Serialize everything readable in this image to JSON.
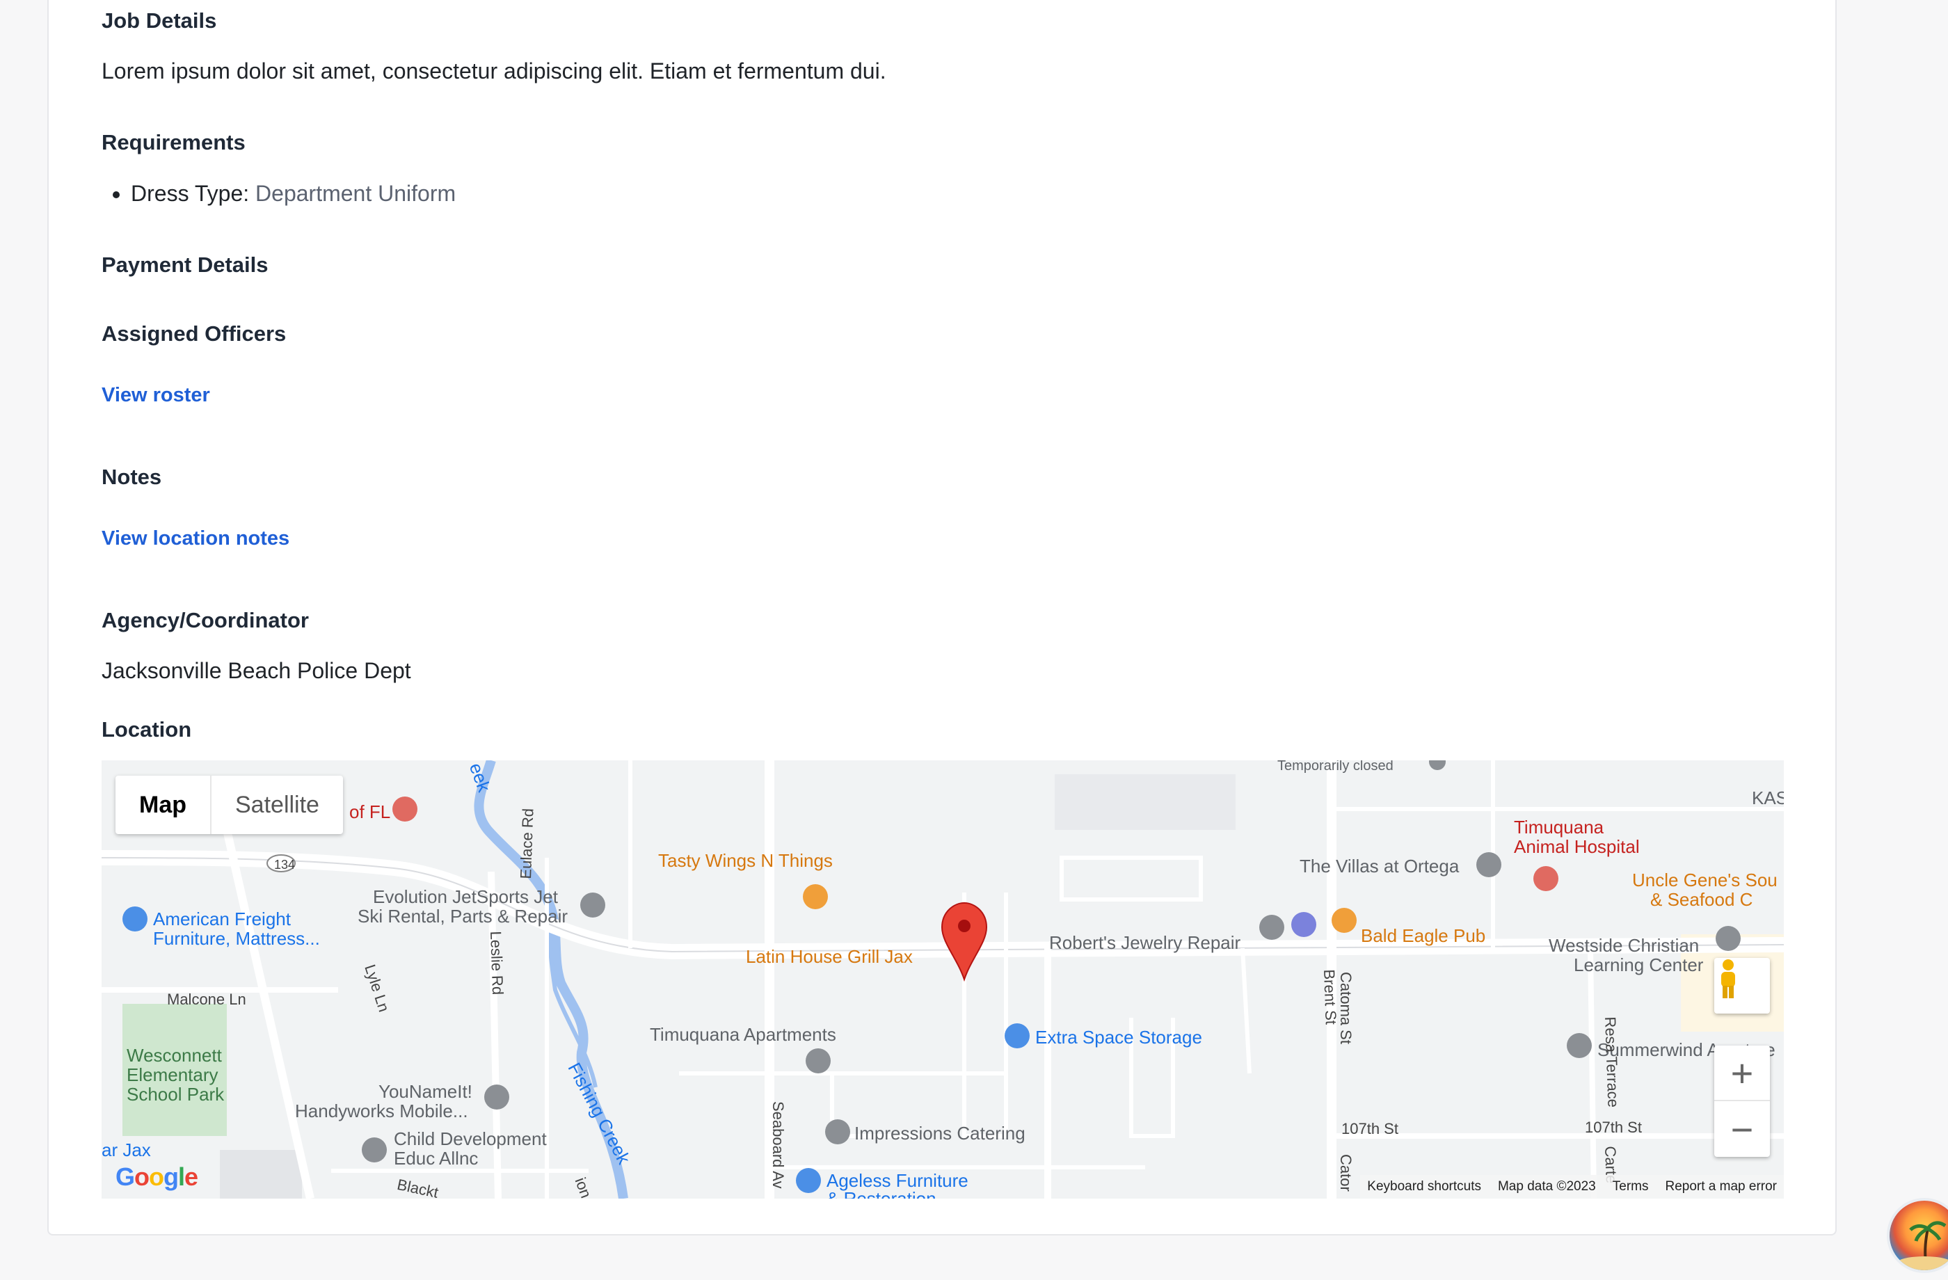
{
  "sections": {
    "job_details": {
      "heading": "Job Details",
      "text": "Lorem ipsum dolor sit amet, consectetur adipiscing elit. Etiam et fermentum dui."
    },
    "requirements": {
      "heading": "Requirements",
      "items": [
        {
          "label": "Dress Type:",
          "value": "Department Uniform"
        }
      ]
    },
    "payment_details": {
      "heading": "Payment Details"
    },
    "assigned_officers": {
      "heading": "Assigned Officers",
      "link": "View roster"
    },
    "notes": {
      "heading": "Notes",
      "link": "View location notes"
    },
    "agency": {
      "heading": "Agency/Coordinator",
      "text": "Jacksonville Beach Police Dept"
    },
    "location": {
      "heading": "Location"
    }
  },
  "map": {
    "type_buttons": {
      "map": "Map",
      "satellite": "Satellite"
    },
    "zoom_in": "+",
    "zoom_out": "−",
    "attribution": {
      "shortcuts": "Keyboard shortcuts",
      "data": "Map data ©2023",
      "terms": "Terms",
      "report": "Report a map error"
    },
    "logo": "Google",
    "labels": {
      "temporarily_closed": "Temporarily closed",
      "kas": "KAS",
      "of_fl": "of FL",
      "highway_134": "134",
      "american_freight_1": "American Freight",
      "american_freight_2": "Furniture, Mattress...",
      "evolution_1": "Evolution JetSports Jet",
      "evolution_2": "Ski Rental, Parts & Repair",
      "tasty_wings": "Tasty Wings N Things",
      "latin_house": "Latin House Grill Jax",
      "roberts_jewelry": "Robert's Jewelry Repair",
      "villas": "The Villas at Ortega",
      "timuquana_hospital_1": "Timuquana",
      "timuquana_hospital_2": "Animal Hospital",
      "uncle_genes_1": "Uncle Gene's Sou",
      "uncle_genes_2": "& Seafood C",
      "bald_eagle": "Bald Eagle Pub",
      "westside_1": "Westside Christian",
      "westside_2": "Learning Center",
      "malcone": "Malcone Ln",
      "wesconnett_1": "Wesconnett",
      "wesconnett_2": "Elementary",
      "wesconnett_3": "School Park",
      "timuquana_apts": "Timuquana Apartments",
      "extra_space": "Extra Space Storage",
      "summerwind": "Summerwind Apartme",
      "younameit_1": "YouNameIt!",
      "younameit_2": "Handyworks Mobile...",
      "child_dev_1": "Child Development",
      "child_dev_2": "Educ Allnc",
      "impressions": "Impressions Catering",
      "ageless_1": "Ageless Furniture",
      "ageless_2": "& Restoration",
      "ar_jax": "ar Jax",
      "fishing_creek": "Fishing Creek",
      "creek_top": "eek",
      "eulace": "Eulace Rd",
      "lyle": "Lyle Ln",
      "leslie": "Leslie Rd",
      "seaboard": "Seaboard Av",
      "brent": "Brent St",
      "catoma": "Catoma St",
      "catoma_b": "Cator",
      "resa": "Resa Terrace",
      "carte": "Carte",
      "st107_a": "107th St",
      "st107_b": "107th St",
      "blackt": "Blackt",
      "ion_rd": "ion Rd"
    }
  },
  "colors": {
    "link": "#1f5fd6",
    "heading": "#1f2937",
    "map_bg": "#f1f3f4",
    "water": "#9fc1f0",
    "park": "#c8e6c9",
    "pin_red": "#ea4335"
  }
}
